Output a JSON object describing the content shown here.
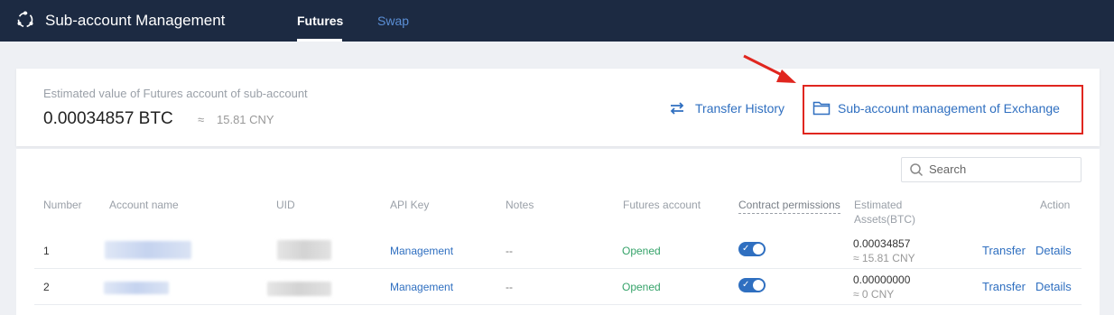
{
  "header": {
    "brand": "Sub-account Management",
    "tabs": [
      {
        "label": "Futures",
        "active": true
      },
      {
        "label": "Swap",
        "active": false
      }
    ]
  },
  "summary": {
    "label": "Estimated value of Futures account of sub-account",
    "value": "0.00034857 BTC",
    "approx_symbol": "≈",
    "cny": "15.81 CNY",
    "transfer_history": "Transfer History",
    "exchange_management": "Sub-account management of Exchange"
  },
  "search": {
    "placeholder": "Search"
  },
  "table": {
    "headers": {
      "number": "Number",
      "account_name": "Account name",
      "uid": "UID",
      "api_key": "API Key",
      "notes": "Notes",
      "futures_account": "Futures account",
      "contract_permissions": "Contract permissions",
      "estimated_line1": "Estimated",
      "estimated_line2": "Assets(BTC)",
      "action": "Action"
    },
    "rows": [
      {
        "number": "1",
        "api_key": "Management",
        "notes": "--",
        "futures_account": "Opened",
        "permission_on": true,
        "est_btc": "0.00034857",
        "est_cny": "≈ 15.81 CNY",
        "transfer": "Transfer",
        "details": "Details"
      },
      {
        "number": "2",
        "api_key": "Management",
        "notes": "--",
        "futures_account": "Opened",
        "permission_on": true,
        "est_btc": "0.00000000",
        "est_cny": "≈ 0 CNY",
        "transfer": "Transfer",
        "details": "Details"
      }
    ]
  },
  "colors": {
    "nav_bg": "#1c2a42",
    "link": "#2f6fc0",
    "opened": "#36a36a",
    "highlight": "#e0261f"
  },
  "icons": [
    "logo-icon",
    "transfer-history-icon",
    "folder-icon",
    "search-icon",
    "annotation-arrow"
  ]
}
